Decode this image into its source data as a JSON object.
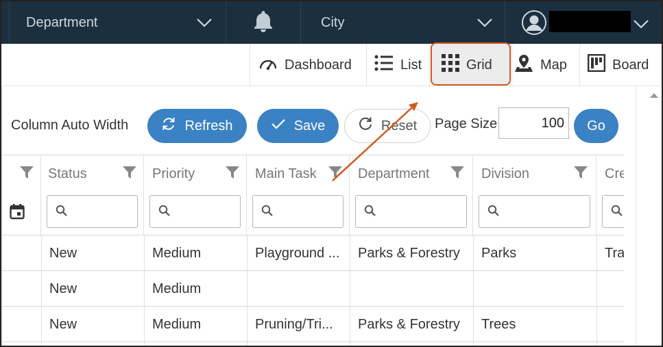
{
  "topbar": {
    "department_label": "Department",
    "city_label": "City"
  },
  "views": {
    "dashboard": "Dashboard",
    "list": "List",
    "grid": "Grid",
    "map": "Map",
    "board": "Board"
  },
  "toolbar": {
    "column_auto_width": "Column Auto Width",
    "refresh": "Refresh",
    "save": "Save",
    "reset": "Reset",
    "page_size_label": "Page Size",
    "page_size_value": "100",
    "go": "Go"
  },
  "grid": {
    "columns": [
      "Status",
      "Priority",
      "Main Task",
      "Department",
      "Division",
      "Cre"
    ],
    "rows": [
      [
        "New",
        "Medium",
        "Playground ...",
        "Parks & Forestry",
        "Parks",
        "Tra"
      ],
      [
        "New",
        "Medium",
        "",
        "",
        "",
        ""
      ],
      [
        "New",
        "Medium",
        "Pruning/Tri...",
        "Parks & Forestry",
        "Trees",
        ""
      ]
    ]
  },
  "colors": {
    "topbar_bg": "#1c2f3e",
    "primary_blue": "#3b82c4",
    "annotation_orange": "#d2591f"
  }
}
